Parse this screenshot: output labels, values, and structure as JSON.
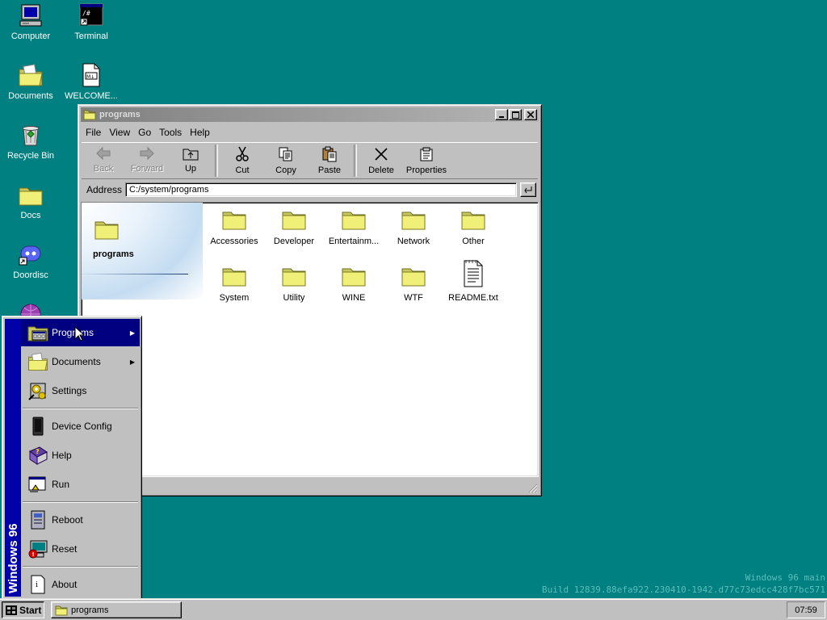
{
  "desktop": {
    "icons": [
      {
        "label": "Computer"
      },
      {
        "label": "Terminal"
      },
      {
        "label": "Documents"
      },
      {
        "label": "WELCOME..."
      },
      {
        "label": "Recycle Bin"
      },
      {
        "label": "Docs"
      },
      {
        "label": "Doordisc"
      }
    ],
    "watermark": {
      "line1": "Windows 96 main",
      "line2": "Build 12839.88efa922.230410-1942.d77c73edcc428f7bc571"
    }
  },
  "window": {
    "title": "programs",
    "menu": [
      "File",
      "View",
      "Go",
      "Tools",
      "Help"
    ],
    "toolbar": {
      "back": "Back",
      "forward": "Forward",
      "up": "Up",
      "cut": "Cut",
      "copy": "Copy",
      "paste": "Paste",
      "delete": "Delete",
      "properties": "Properties"
    },
    "address_label": "Address",
    "address_value": "C:/system/programs",
    "folder_banner_title": "programs",
    "items": [
      {
        "name": "Accessories",
        "type": "folder"
      },
      {
        "name": "Developer",
        "type": "folder"
      },
      {
        "name": "Entertainm...",
        "type": "folder"
      },
      {
        "name": "Network",
        "type": "folder"
      },
      {
        "name": "Other",
        "type": "folder"
      },
      {
        "name": "System",
        "type": "folder"
      },
      {
        "name": "Utility",
        "type": "folder"
      },
      {
        "name": "WINE",
        "type": "folder"
      },
      {
        "name": "WTF",
        "type": "folder"
      },
      {
        "name": "README.txt",
        "type": "text-file"
      }
    ]
  },
  "start_menu": {
    "side_label": "Windows 96",
    "items": [
      {
        "label": "Programs",
        "icon": "programs-icon",
        "submenu": true
      },
      {
        "label": "Documents",
        "icon": "documents-folder-icon",
        "submenu": true
      },
      {
        "label": "Settings",
        "icon": "settings-icon"
      },
      {
        "label": "Device Config",
        "icon": "device-icon"
      },
      {
        "label": "Help",
        "icon": "help-book-icon"
      },
      {
        "label": "Run",
        "icon": "run-icon"
      },
      {
        "label": "Reboot",
        "icon": "reboot-icon"
      },
      {
        "label": "Reset",
        "icon": "reset-icon"
      },
      {
        "label": "About",
        "icon": "about-icon"
      }
    ]
  },
  "taskbar": {
    "start_label": "Start",
    "task_label": "programs",
    "clock": "07:59"
  },
  "colors": {
    "desktop": "#008080",
    "selection": "#000080",
    "sidebar": "#0000a8"
  }
}
